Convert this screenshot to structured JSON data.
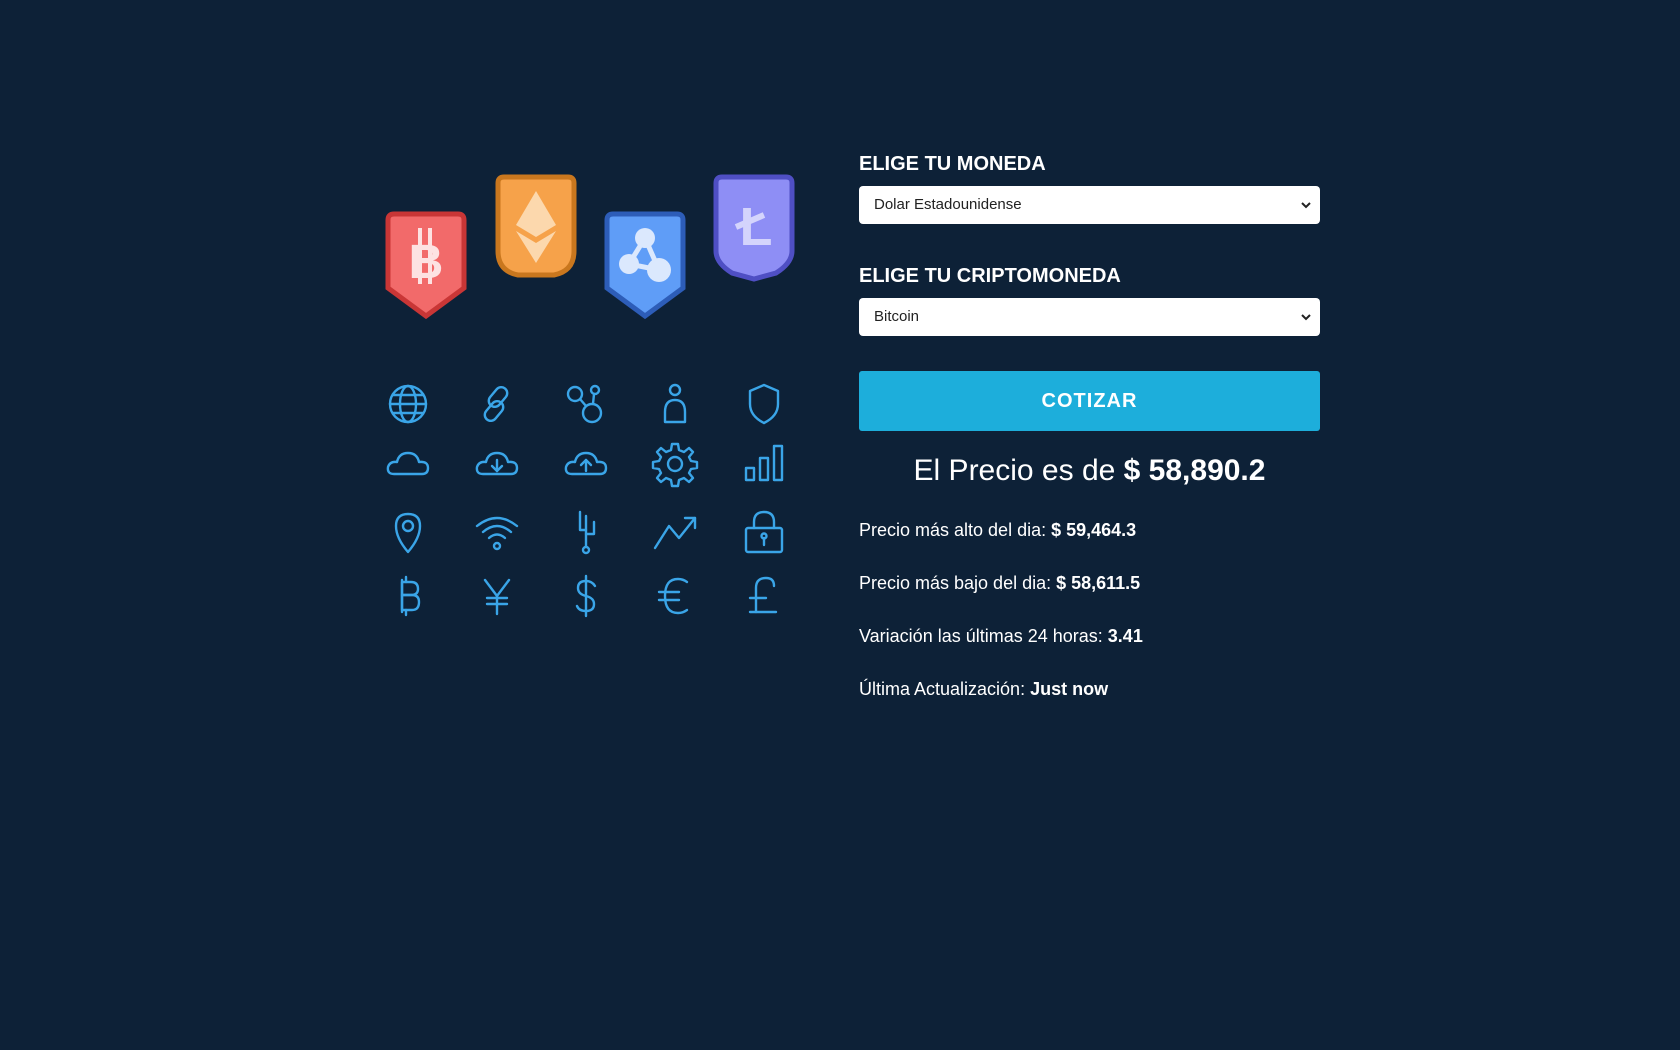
{
  "form": {
    "currency_label": "ELIGE TU MONEDA",
    "currency_selected": "Dolar Estadounidense",
    "crypto_label": "ELIGE TU CRIPTOMONEDA",
    "crypto_selected": "Bitcoin",
    "submit_label": "COTIZAR"
  },
  "result": {
    "price_prefix": "El Precio es de ",
    "price_value": "$ 58,890.2",
    "high_label": "Precio más alto del dia: ",
    "high_value": "$ 59,464.3",
    "low_label": "Precio más bajo del dia: ",
    "low_value": "$ 58,611.5",
    "change_label": "Variación las últimas 24 horas: ",
    "change_value": "3.41",
    "updated_label": "Última Actualización: ",
    "updated_value": "Just now"
  },
  "illustration": {
    "badges": [
      {
        "icon": "bitcoin-icon",
        "color": "#f26a6a",
        "border": "#c93636"
      },
      {
        "icon": "ethereum-icon",
        "color": "#f6a24a",
        "border": "#c9771e"
      },
      {
        "icon": "ripple-icon",
        "color": "#5f9df7",
        "border": "#2d5db8"
      },
      {
        "icon": "litecoin-icon",
        "color": "#8e8ef5",
        "border": "#4f4fc4"
      }
    ],
    "icons": [
      "globe-icon",
      "link-icon",
      "network-icon",
      "user-icon",
      "shield-icon",
      "cloud-icon",
      "cloud-download-icon",
      "cloud-upload-icon",
      "gear-icon",
      "bar-chart-icon",
      "location-pin-icon",
      "wifi-icon",
      "circuit-icon",
      "trend-up-icon",
      "lock-icon",
      "bitcoin-symbol-icon",
      "yen-icon",
      "dollar-icon",
      "euro-icon",
      "pound-icon"
    ],
    "icon_color": "#3aa5e8"
  },
  "colors": {
    "background": "#0d2137",
    "accent": "#1daedb"
  }
}
